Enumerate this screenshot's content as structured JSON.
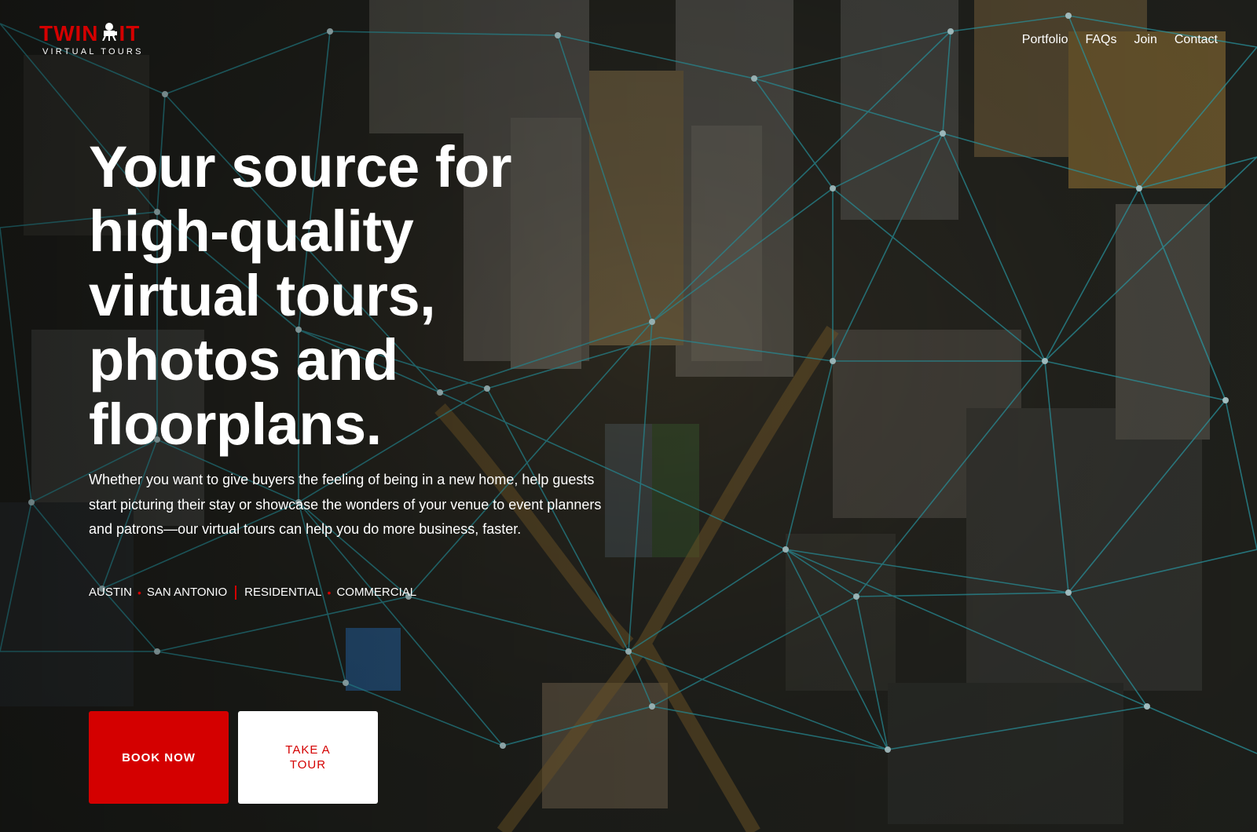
{
  "brand": {
    "name_left": "TWIN",
    "name_right": "IT",
    "tagline": "VIRTUAL TOURS",
    "logo_icon": "camera-icon",
    "accent_color": "#d40000"
  },
  "nav": {
    "items": [
      {
        "label": "Portfolio"
      },
      {
        "label": "FAQs"
      },
      {
        "label": "Join"
      },
      {
        "label": "Contact"
      }
    ]
  },
  "hero": {
    "headline": "Your source for high-quality virtual tours, photos and floorplans.",
    "lead": "Whether you want to give buyers the feeling of being in a new home, help guests start picturing their stay or showcase the wonders of your venue to event planners and patrons—our virtual tours can help you do more business, faster.",
    "tags": {
      "locations": [
        "AUSTIN",
        "SAN ANTONIO"
      ],
      "categories": [
        "RESIDENTIAL",
        "COMMERCIAL"
      ]
    },
    "buttons": {
      "primary": "BOOK NOW",
      "secondary": "TAKE A TOUR"
    }
  }
}
